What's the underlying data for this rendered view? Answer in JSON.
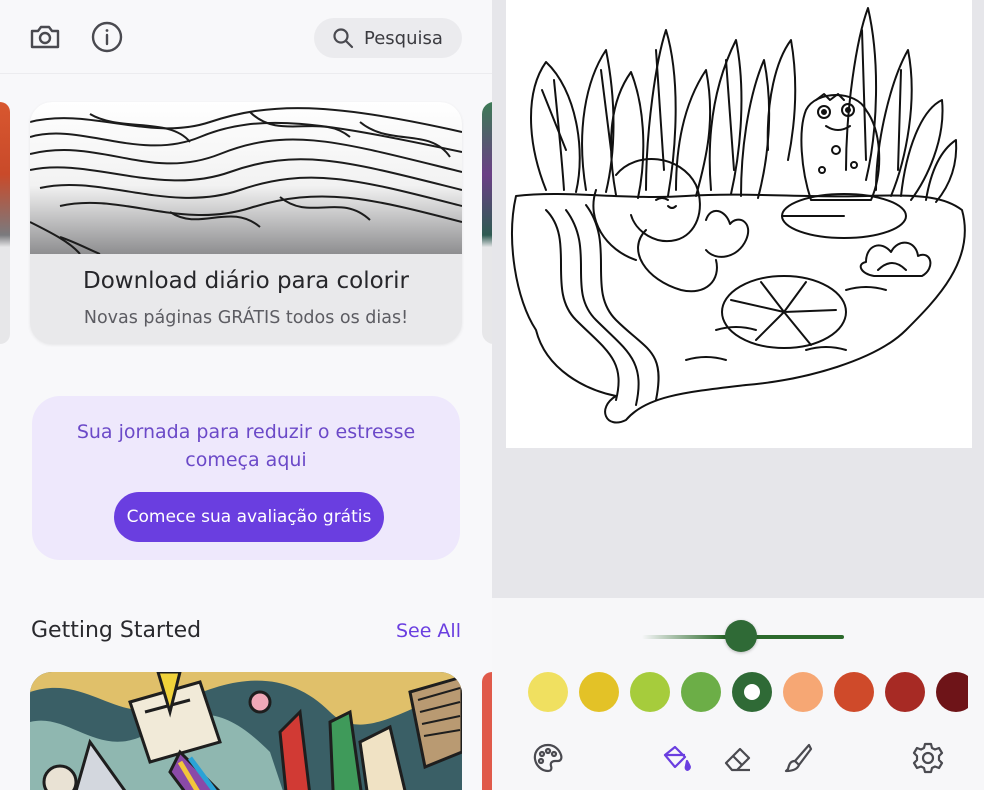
{
  "left_panel": {
    "search": {
      "label": "Pesquisa"
    },
    "daily_card": {
      "title": "Download diário para colorir",
      "subtitle": "Novas páginas GRÁTIS todos os dias!"
    },
    "promo": {
      "text_line1": "Sua jornada para reduzir o estresse",
      "text_line2": "começa aqui",
      "button": "Comece sua avaliação grátis"
    },
    "section": {
      "title": "Getting Started",
      "see_all": "See All"
    }
  },
  "right_panel": {
    "brush_size": 0.49,
    "palette": [
      "#f0e060",
      "#e3c227",
      "#a6cc3c",
      "#6cae47",
      "#2f6a36",
      "#f6a774",
      "#cf4a2a",
      "#a72a24",
      "#6e1418"
    ],
    "selected_color": "#2f6a36"
  },
  "colors": {
    "accent": "#6a3ee0",
    "promo_bg": "#eee8fc",
    "promo_text": "#6b49c8"
  }
}
